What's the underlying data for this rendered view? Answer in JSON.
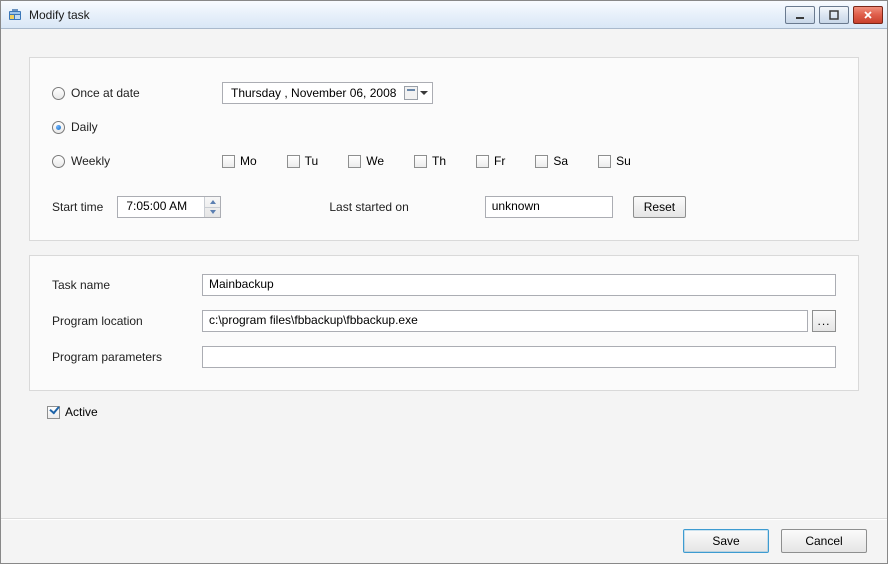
{
  "window": {
    "title": "Modify task"
  },
  "schedule": {
    "options": {
      "once": "Once at date",
      "daily": "Daily",
      "weekly": "Weekly"
    },
    "selected": "daily",
    "date": "Thursday  , November 06, 2008",
    "weekdays": {
      "mo": "Mo",
      "tu": "Tu",
      "we": "We",
      "th": "Th",
      "fr": "Fr",
      "sa": "Sa",
      "su": "Su"
    },
    "start_time_label": "Start time",
    "start_time": "7:05:00 AM",
    "last_started_label": "Last started on",
    "last_started": "unknown",
    "reset_label": "Reset"
  },
  "task": {
    "name_label": "Task name",
    "name": "Mainbackup",
    "program_location_label": "Program location",
    "program_location": "c:\\program files\\fbbackup\\fbbackup.exe",
    "program_parameters_label": "Program parameters",
    "program_parameters": "",
    "browse_label": "..."
  },
  "active": {
    "label": "Active",
    "checked": true
  },
  "buttons": {
    "save": "Save",
    "cancel": "Cancel"
  }
}
